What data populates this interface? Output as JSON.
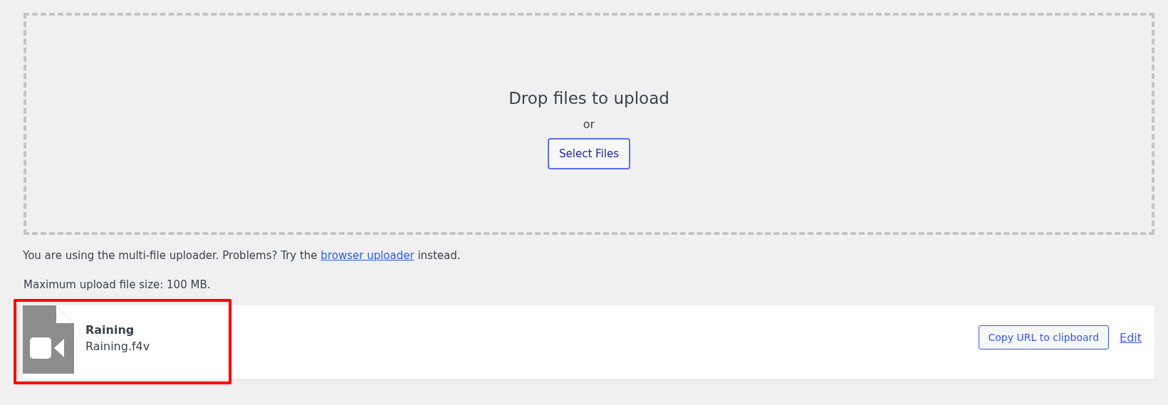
{
  "dropzone": {
    "title": "Drop files to upload",
    "or": "or",
    "button": "Select Files"
  },
  "notice": {
    "before": "You are using the multi-file uploader. Problems? Try the ",
    "link": "browser uploader",
    "after": " instead."
  },
  "max_size": "Maximum upload file size: 100 MB.",
  "items": [
    {
      "title": "Raining",
      "filename": "Raining.f4v",
      "copy_button": "Copy URL to clipboard",
      "edit_link": "Edit",
      "highlighted": true
    }
  ]
}
